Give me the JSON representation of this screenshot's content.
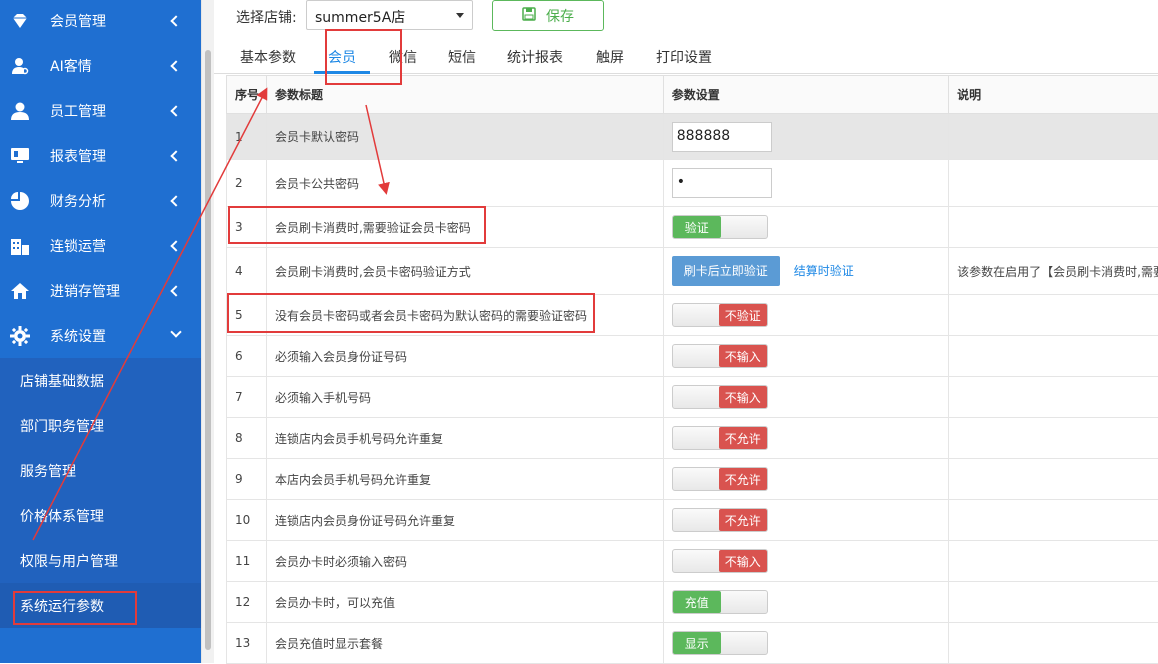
{
  "sidebar": {
    "items": [
      {
        "label": "会员管理",
        "icon": "diamond-icon"
      },
      {
        "label": "AI客情",
        "icon": "user-key-icon"
      },
      {
        "label": "员工管理",
        "icon": "user-icon"
      },
      {
        "label": "报表管理",
        "icon": "monitor-icon"
      },
      {
        "label": "财务分析",
        "icon": "pie-chart-icon"
      },
      {
        "label": "连锁运营",
        "icon": "building-icon"
      },
      {
        "label": "进销存管理",
        "icon": "home-icon"
      },
      {
        "label": "系统设置",
        "icon": "gear-icon"
      }
    ],
    "subitems": [
      "店铺基础数据",
      "部门职务管理",
      "服务管理",
      "价格体系管理",
      "权限与用户管理",
      "系统运行参数"
    ]
  },
  "topbar": {
    "store_label": "选择店铺:",
    "store_value": "summer5A店",
    "save_label": "保存"
  },
  "tabs": [
    "基本参数",
    "会员",
    "微信",
    "短信",
    "统计报表",
    "触屏",
    "打印设置"
  ],
  "active_tab": "会员",
  "table": {
    "headers": [
      "序号",
      "参数标题",
      "参数设置",
      "说明"
    ],
    "rows": [
      {
        "no": "1",
        "title": "会员卡默认密码",
        "type": "input",
        "value": "888888",
        "note": ""
      },
      {
        "no": "2",
        "title": "会员卡公共密码",
        "type": "input",
        "value": "•",
        "note": ""
      },
      {
        "no": "3",
        "title": "会员刷卡消费时,需要验证会员卡密码",
        "type": "toggle-on",
        "value": "验证",
        "note": ""
      },
      {
        "no": "4",
        "title": "会员刷卡消费时,会员卡密码验证方式",
        "type": "buttons",
        "value": "刷卡后立即验证",
        "alt": "结算时验证",
        "note": "该参数在启用了【会员刷卡消费时,需要"
      },
      {
        "no": "5",
        "title": "没有会员卡密码或者会员卡密码为默认密码的需要验证密码",
        "type": "toggle-off",
        "value": "不验证",
        "note": ""
      },
      {
        "no": "6",
        "title": "必须输入会员身份证号码",
        "type": "toggle-off",
        "value": "不输入",
        "note": ""
      },
      {
        "no": "7",
        "title": "必须输入手机号码",
        "type": "toggle-off",
        "value": "不输入",
        "note": ""
      },
      {
        "no": "8",
        "title": "连锁店内会员手机号码允许重复",
        "type": "toggle-off",
        "value": "不允许",
        "note": ""
      },
      {
        "no": "9",
        "title": "本店内会员手机号码允许重复",
        "type": "toggle-off",
        "value": "不允许",
        "note": ""
      },
      {
        "no": "10",
        "title": "连锁店内会员身份证号码允许重复",
        "type": "toggle-off",
        "value": "不允许",
        "note": ""
      },
      {
        "no": "11",
        "title": "会员办卡时必须输入密码",
        "type": "toggle-off",
        "value": "不输入",
        "note": ""
      },
      {
        "no": "12",
        "title": "会员办卡时，可以充值",
        "type": "toggle-on",
        "value": "充值",
        "note": ""
      },
      {
        "no": "13",
        "title": "会员充值时显示套餐",
        "type": "toggle-on",
        "value": "显示",
        "note": ""
      }
    ]
  }
}
